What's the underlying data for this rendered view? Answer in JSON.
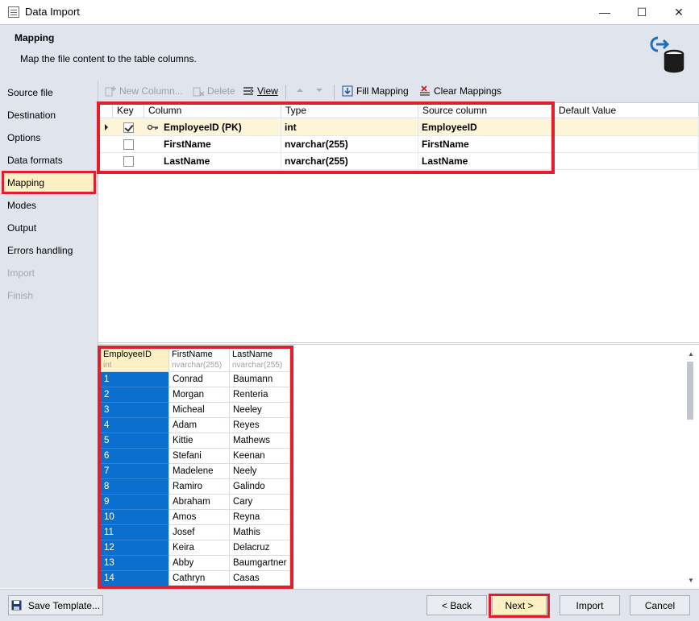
{
  "window": {
    "title": "Data Import",
    "minimize_glyph": "—",
    "maximize_glyph": "☐",
    "close_glyph": "✕"
  },
  "header": {
    "title": "Mapping",
    "description": "Map the file content to the table columns.",
    "icon": "import-to-database-icon"
  },
  "sidebar": {
    "items": [
      {
        "label": "Source file",
        "state": "normal"
      },
      {
        "label": "Destination",
        "state": "normal"
      },
      {
        "label": "Options",
        "state": "normal"
      },
      {
        "label": "Data formats",
        "state": "normal"
      },
      {
        "label": "Mapping",
        "state": "active"
      },
      {
        "label": "Modes",
        "state": "normal"
      },
      {
        "label": "Output",
        "state": "normal"
      },
      {
        "label": "Errors handling",
        "state": "normal"
      },
      {
        "label": "Import",
        "state": "disabled"
      },
      {
        "label": "Finish",
        "state": "disabled"
      }
    ]
  },
  "toolbar": {
    "new_column_label": "New Column...",
    "delete_label": "Delete",
    "view_label": "View",
    "fill_mapping_label": "Fill Mapping",
    "clear_mappings_label": "Clear Mappings"
  },
  "mapping_grid": {
    "headers": [
      "Key",
      "Column",
      "Type",
      "Source column",
      "Default Value"
    ],
    "rows": [
      {
        "key": true,
        "column": "EmployeeID (PK)",
        "type": "int",
        "source": "EmployeeID",
        "default": ""
      },
      {
        "key": false,
        "column": "FirstName",
        "type": "nvarchar(255)",
        "source": "FirstName",
        "default": ""
      },
      {
        "key": false,
        "column": "LastName",
        "type": "nvarchar(255)",
        "source": "LastName",
        "default": ""
      }
    ]
  },
  "preview": {
    "columns": [
      {
        "name": "EmployeeID",
        "type": "int"
      },
      {
        "name": "FirstName",
        "type": "nvarchar(255)"
      },
      {
        "name": "LastName",
        "type": "nvarchar(255)"
      }
    ],
    "rows": [
      [
        "1",
        "Conrad",
        "Baumann"
      ],
      [
        "2",
        "Morgan",
        "Renteria"
      ],
      [
        "3",
        "Micheal",
        "Neeley"
      ],
      [
        "4",
        "Adam",
        "Reyes"
      ],
      [
        "5",
        "Kittie",
        "Mathews"
      ],
      [
        "6",
        "Stefani",
        "Keenan"
      ],
      [
        "7",
        "Madelene",
        "Neely"
      ],
      [
        "8",
        "Ramiro",
        "Galindo"
      ],
      [
        "9",
        "Abraham",
        "Cary"
      ],
      [
        "10",
        "Amos",
        "Reyna"
      ],
      [
        "11",
        "Josef",
        "Mathis"
      ],
      [
        "12",
        "Keira",
        "Delacruz"
      ],
      [
        "13",
        "Abby",
        "Baumgartner"
      ],
      [
        "14",
        "Cathryn",
        "Casas"
      ]
    ]
  },
  "footer": {
    "save_template_label": "Save Template...",
    "back_label": "< Back",
    "next_label": "Next >",
    "import_label": "Import",
    "cancel_label": "Cancel"
  },
  "colors": {
    "accent_highlight": "#e11e2b",
    "selected_row": "#fdf1c4",
    "key_cell": "#0b6fd0",
    "panel_bg": "#dfe4ed"
  }
}
